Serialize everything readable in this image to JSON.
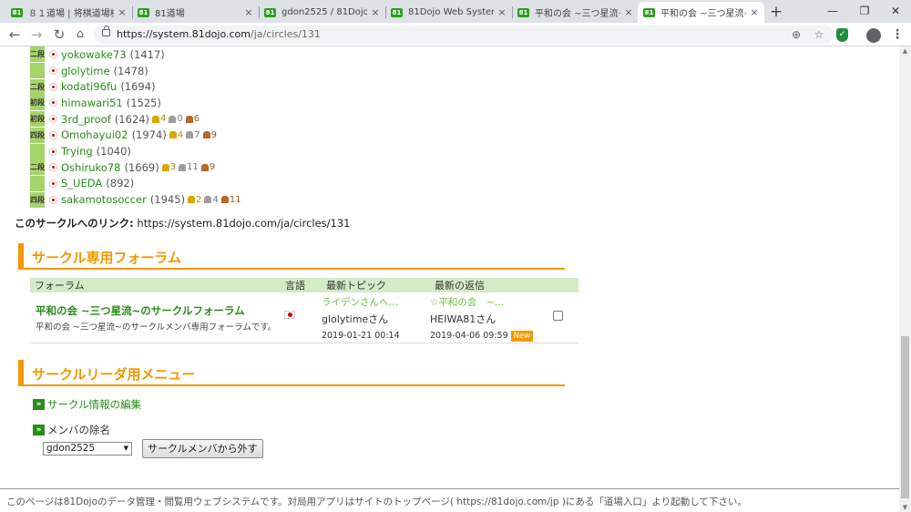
{
  "browser": {
    "tabs": [
      {
        "icon": "81",
        "title": "８１道場 | 将棋道場検"
      },
      {
        "icon": "81",
        "title": "81道場"
      },
      {
        "icon": "81",
        "title": "gdon2525 / 81Dojo We"
      },
      {
        "icon": "81",
        "title": "81Dojo Web System"
      },
      {
        "icon": "81",
        "title": "平和の会 ~三つ星流~ / 8"
      },
      {
        "icon": "81",
        "title": "平和の会 ~三つ星流~ / 8"
      }
    ],
    "new_tab": "+",
    "window_controls": {
      "minimize": "—",
      "restore": "❐",
      "close": "✕"
    },
    "url_host": "https://system.81dojo.com",
    "url_path": "/ja/circles/131"
  },
  "members": [
    {
      "rank": "二段",
      "name": "yokowake73",
      "rating": "(1417)",
      "medals": []
    },
    {
      "rank": "",
      "name": "glolytime",
      "rating": "(1478)",
      "medals": []
    },
    {
      "rank": "二段",
      "name": "kodati96fu",
      "rating": "(1694)",
      "medals": []
    },
    {
      "rank": "初段",
      "name": "himawari51",
      "rating": "(1525)",
      "medals": []
    },
    {
      "rank": "初段",
      "name": "3rd_proof",
      "rating": "(1624)",
      "medals": [
        {
          "type": "gold",
          "count": "4"
        },
        {
          "type": "silver",
          "count": "0"
        },
        {
          "type": "bronze",
          "count": "6"
        }
      ]
    },
    {
      "rank": "四段",
      "name": "Omohayui02",
      "rating": "(1974)",
      "medals": [
        {
          "type": "gold",
          "count": "4"
        },
        {
          "type": "silver",
          "count": "7"
        },
        {
          "type": "bronze",
          "count": "9"
        }
      ]
    },
    {
      "rank": "",
      "name": "Trying",
      "rating": "(1040)",
      "medals": []
    },
    {
      "rank": "二段",
      "name": "Oshiruko78",
      "rating": "(1669)",
      "medals": [
        {
          "type": "gold",
          "count": "3"
        },
        {
          "type": "silver",
          "count": "11"
        },
        {
          "type": "bronze",
          "count": "9"
        }
      ]
    },
    {
      "rank": "",
      "name": "S_UEDA",
      "rating": "(892)",
      "medals": []
    },
    {
      "rank": "四段",
      "name": "sakamotosoccer",
      "rating": "(1945)",
      "medals": [
        {
          "type": "gold",
          "count": "2"
        },
        {
          "type": "silver",
          "count": "4"
        },
        {
          "type": "bronze",
          "count": "11"
        }
      ]
    }
  ],
  "circle_link": {
    "label": "このサークルへのリンク:",
    "url": " https://system.81dojo.com/ja/circles/131"
  },
  "forum_section": {
    "title": "サークル専用フォーラム",
    "headers": {
      "forum": "フォーラム",
      "lang": "言語",
      "latest_topic": "最新トピック",
      "latest_reply": "最新の返信"
    },
    "row": {
      "name": "平和の会 ~三つ星流~のサークルフォーラム",
      "desc": "平和の会 ~三つ星流~のサークルメンバ専用フォーラムです。",
      "topic_title": "ライデンさんへ…",
      "topic_user": "glolytimeさん",
      "topic_date": "2019-01-21 00:14",
      "reply_title": "☆平和の会　~…",
      "reply_user": "HEIWA81さん",
      "reply_date": "2019-04-06 09:59",
      "badge": "New"
    }
  },
  "leader_section": {
    "title": "サークルリーダ用メニュー",
    "edit_link": "サークル情報の編集",
    "remove_label": "メンバの除名",
    "select_value": "gdon2525",
    "remove_button": "サークルメンバから外す"
  },
  "footer": {
    "text": "このページは81Dojoのデータ管理・閲覧用ウェブシステムです。対局用アプリはサイトのトップページ( https://81dojo.com/jp )にある「道場入口」より起動して下さい。"
  },
  "colors": {
    "accent": "#f39800",
    "link": "#2a8c1c",
    "table_header": "#d4ebc7"
  }
}
